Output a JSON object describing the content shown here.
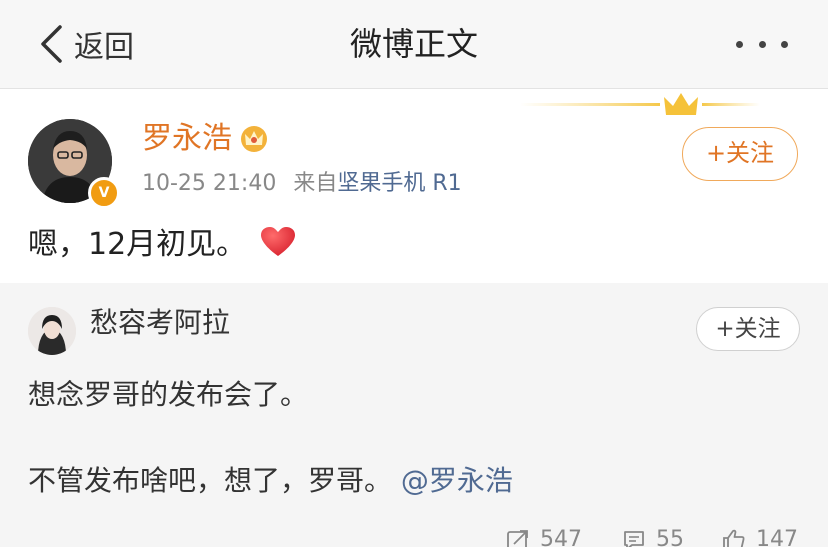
{
  "nav": {
    "back_label": "返回",
    "title": "微博正文"
  },
  "post": {
    "author": "罗永浩",
    "verified_badge": "V",
    "time": "10-25 21:40",
    "source_prefix": "来自",
    "source_device": "坚果手机 R1",
    "follow_label": "+关注",
    "text": "嗯，12月初见。",
    "accent_color": "#e07525"
  },
  "repost": {
    "author": "愁容考阿拉",
    "follow_label": "+关注",
    "line1": "想念罗哥的发布会了。",
    "line2": "不管发布啥吧，想了，罗哥。",
    "mention": "@罗永浩",
    "stats": {
      "reposts": "547",
      "comments": "55",
      "likes": "147"
    }
  },
  "icons": [
    "chevron-left-icon",
    "more-dots-icon",
    "vip-crown-icon",
    "heart-icon",
    "repost-icon",
    "comment-icon",
    "like-icon"
  ]
}
